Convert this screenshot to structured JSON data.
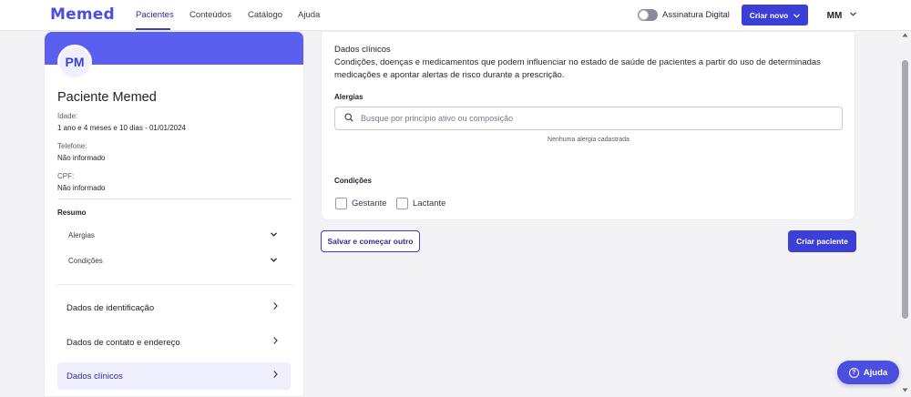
{
  "nav": {
    "logo": "Memed",
    "tabs": [
      {
        "label": "Pacientes"
      },
      {
        "label": "Conteúdos"
      },
      {
        "label": "Catálogo"
      },
      {
        "label": "Ajuda"
      }
    ],
    "toggle_label": "Assinatura Digital",
    "cta_label": "Criar novo",
    "user_initials": "MM"
  },
  "patient": {
    "initials": "PM",
    "name": "Paciente Memed",
    "age_label": "Idade:",
    "age_value": "1 ano e 4 meses e 10 dias - 01/01/2024",
    "phone_label": "Telefone:",
    "phone_value": "Não informado",
    "cpf_label": "CPF:",
    "cpf_value": "Não informado"
  },
  "summary": {
    "title": "Resumo",
    "items": [
      {
        "label": "Alergias"
      },
      {
        "label": "Condições"
      }
    ]
  },
  "sections": [
    {
      "label": "Dados de identificação"
    },
    {
      "label": "Dados de contato e endereço"
    },
    {
      "label": "Dados clínicos"
    }
  ],
  "clinical": {
    "title": "Dados clínicos",
    "description": "Condições, doenças e medicamentos que podem influenciar no estado de saúde de pacientes a partir do uso de determinadas medicações e apontar alertas de risco durante a prescrição.",
    "allergies_label": "Alergias",
    "search_placeholder": "Busque por princípio ativo ou composição",
    "empty_message": "Nenhuma alergia cadastrada",
    "conditions_label": "Condições",
    "conditions": [
      {
        "label": "Gestante"
      },
      {
        "label": "Lactante"
      }
    ]
  },
  "actions": {
    "save_and_new": "Salvar e começar outro",
    "create_patient": "Criar paciente"
  },
  "help": {
    "label": "Ajuda"
  }
}
